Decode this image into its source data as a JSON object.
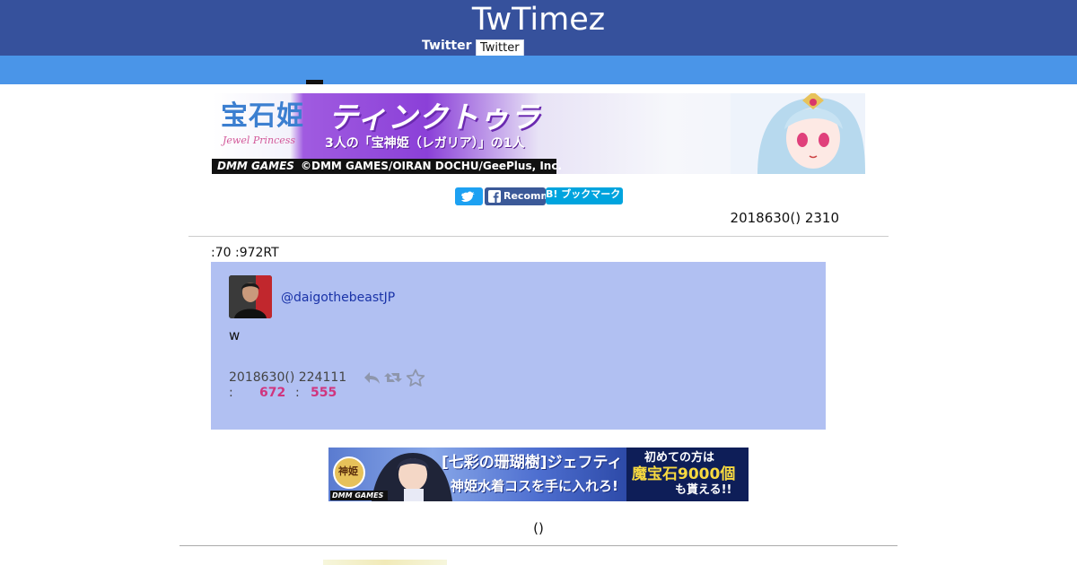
{
  "header": {
    "site_title": "TwTimez",
    "twitter_label": "Twitter",
    "twitter_button": "Twitter",
    "background": "#36519c"
  },
  "subbar": {
    "background": "#4a95e8"
  },
  "ad_banner_top": {
    "logo": "宝石姫",
    "logo_sub": "Jewel Princess",
    "heading": "ティンクトゥラ",
    "tagline": "3人の「宝神姫（レガリア）」の1人",
    "brand": "DMM GAMES",
    "copyright": "©DMM GAMES/OIRAN DOCHU/GeePlus, Inc."
  },
  "share": {
    "facebook_label": "Recommend",
    "hatena_label": "B! ブックマーク"
  },
  "page_date": "2018630() 2310",
  "stats_line": ":70 :972RT",
  "tweet": {
    "username": "@daigothebeastJP",
    "text": "w",
    "timestamp": "2018630() 224111",
    "sep1": ":",
    "retweets": "672",
    "sep2": ":",
    "favorites": "555",
    "card_color": "#b1c0f2",
    "count_color": "#d0357e"
  },
  "ad_banner_bottom": {
    "badge": "神姫",
    "brand": "DMM GAMES",
    "title": "[七彩の珊瑚樹]ジェフティ",
    "subtitle": "神姫水着コスを手に入れろ!",
    "right_line1": "初めての方は",
    "right_line2": "魔宝石9000個",
    "right_line3": "も貰える!!"
  },
  "footer": {
    "paren_text": "()"
  }
}
